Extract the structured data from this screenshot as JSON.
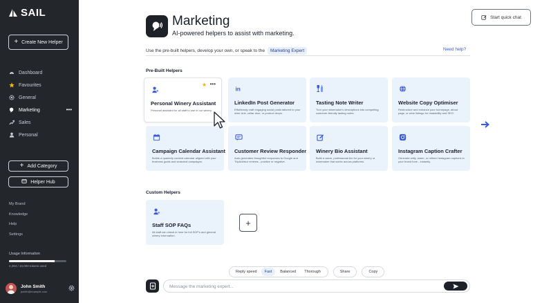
{
  "sidebar": {
    "brand": "SAIL",
    "create_helper": "Create New Helper",
    "nav": [
      {
        "label": "Dashboard",
        "icon": "dashboard-icon"
      },
      {
        "label": "Favourites",
        "icon": "star-icon"
      },
      {
        "label": "General",
        "icon": "gear-icon"
      },
      {
        "label": "Marketing",
        "icon": "megaphone-icon",
        "active": true
      },
      {
        "label": "Sales",
        "icon": "trend-icon"
      },
      {
        "label": "Personal",
        "icon": "person-icon"
      }
    ],
    "add_category": "Add Category",
    "helper_hub": "Helper Hub",
    "links": [
      "My Brand",
      "Knowledge",
      "Help",
      "Settings"
    ],
    "usage": {
      "label": "Usage Information",
      "fraction": 0.8,
      "count": "2,284 / 10,000 tokens used"
    },
    "user": {
      "name": "John Smith",
      "email": "jsmith@example.com"
    }
  },
  "header": {
    "title": "Marketing",
    "subtitle": "AI-powered helpers to assist with marketing.",
    "quick_chat": "Start quick chat"
  },
  "intro": {
    "text": "Use the pre-built helpers, develop your own, or speak to the",
    "expert": "Marketing Expert",
    "help": "Need help?"
  },
  "prebuilt": {
    "title": "Pre-Built Helpers",
    "cards": [
      {
        "title": "Personal Winery Assistant",
        "desc": "Personal assistant for all staff to use in our winery.",
        "icon": "person-icon"
      },
      {
        "title": "LinkedIn Post Generator",
        "desc": "Effortlessly craft engaging social posts tailored to your wine club, cellar door, or product drops.",
        "icon": "linkedin-icon"
      },
      {
        "title": "Tasting Note Writer",
        "desc": "Turn your winemaker's descriptions into compelling, customer-friendly tasting notes.",
        "icon": "wine-icon"
      },
      {
        "title": "Website Copy Optimiser",
        "desc": "Restructure and enhance your homepage, about page, or wine listings for readability and SEO.",
        "icon": "globe-icon"
      },
      {
        "title": "Campaign Calendar Assistant",
        "desc": "Builds a quarterly content calendar aligned with your business goals and seasonal campaigns.",
        "icon": "calendar-icon"
      },
      {
        "title": "Customer Review Responder",
        "desc": "Auto-generates thoughtful responses to Google and TripAdvisor reviews - positive or negative.",
        "icon": "chat-icon"
      },
      {
        "title": "Winery Bio Assistant",
        "desc": "Build a warm, professional bio for your winery or winemaker that works across platforms.",
        "icon": "edit-icon"
      },
      {
        "title": "Instagram Caption Crafter",
        "desc": "Generate witty, warm, or refined Instagram captions in your brand tone - instantly.",
        "icon": "instagram-icon"
      }
    ]
  },
  "custom": {
    "title": "Custom Helpers",
    "cards": [
      {
        "title": "Staff SOP FAQs",
        "desc": "All staff can check in here for full SOP's and general winery information.",
        "icon": "person-icon"
      }
    ]
  },
  "toolbar": {
    "reply_speed": "Reply speed",
    "options": [
      "Fast",
      "Balanced",
      "Thorough"
    ],
    "selected": "Fast",
    "share": "Share",
    "copy": "Copy"
  },
  "composer": {
    "placeholder": "Message the marketing expert..."
  },
  "colors": {
    "sidebar": "#23262b",
    "card": "#eaf2fb",
    "accent": "#3b5bdb",
    "dark": "#1e2228"
  }
}
